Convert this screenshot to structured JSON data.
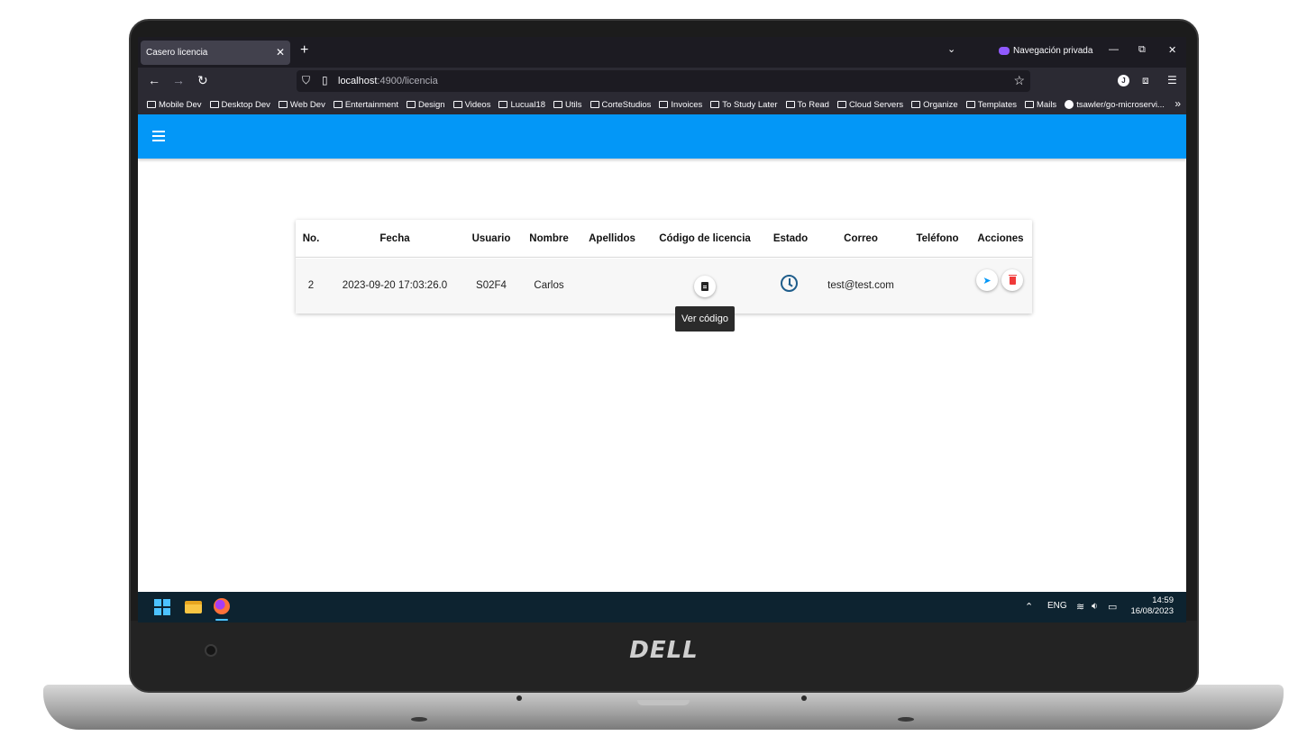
{
  "browser": {
    "tab_title": "Casero licencia",
    "private_label": "Navegación privada",
    "url_host": "localhost",
    "url_path": ":4900/licencia",
    "bookmarks": [
      "Mobile Dev",
      "Desktop Dev",
      "Web Dev",
      "Entertainment",
      "Design",
      "Videos",
      "Lucual18",
      "Utils",
      "CorteStudios",
      "Invoices",
      "To Study Later",
      "To Read",
      "Cloud Servers",
      "Organize",
      "Templates",
      "Mails"
    ],
    "bookmark_link": "tsawler/go-microservi...",
    "profile_initial": "J"
  },
  "app": {
    "header_color": "#0397f7"
  },
  "table": {
    "headers": [
      "No.",
      "Fecha",
      "Usuario",
      "Nombre",
      "Apellidos",
      "Código de licencia",
      "Estado",
      "Correo",
      "Teléfono",
      "Acciones"
    ],
    "rows": [
      {
        "no": "2",
        "fecha": "2023-09-20 17:03:26.0",
        "usuario": "S02F4",
        "nombre": "Carlos",
        "apellidos": "",
        "codigo_icon": "document-icon",
        "estado_icon": "clock-icon",
        "correo": "test@test.com",
        "telefono": ""
      }
    ],
    "tooltip": "Ver código"
  },
  "taskbar": {
    "language": "ENG",
    "time": "14:59",
    "date": "16/08/2023"
  },
  "device": {
    "brand": "DELL"
  }
}
